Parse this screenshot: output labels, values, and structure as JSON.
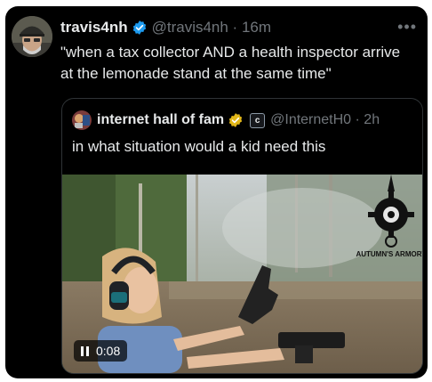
{
  "tweet": {
    "author": {
      "display_name": "travis4nh",
      "verified": true,
      "handle_time": "@travis4nh · 16m"
    },
    "more_icon": "more-icon",
    "text": "\"when a tax collector AND a health inspector arrive at the lemonade stand at the same time\""
  },
  "quote": {
    "author": {
      "display_name": "internet hall of fam",
      "verified": true,
      "affiliate_badge": "c",
      "handle_time": "@InternetH0 · 2h"
    },
    "text": "in what situation would a kid need this",
    "media": {
      "watermark": "AUTUMN'S ARMORY",
      "video_time": "0:08",
      "playing": true
    }
  },
  "colors": {
    "background": "#000000",
    "text": "#e7e9ea",
    "secondary": "#71767b",
    "verified_blue": "#1d9bf0",
    "verified_gold": "#e2b719",
    "border": "#2f3336"
  }
}
